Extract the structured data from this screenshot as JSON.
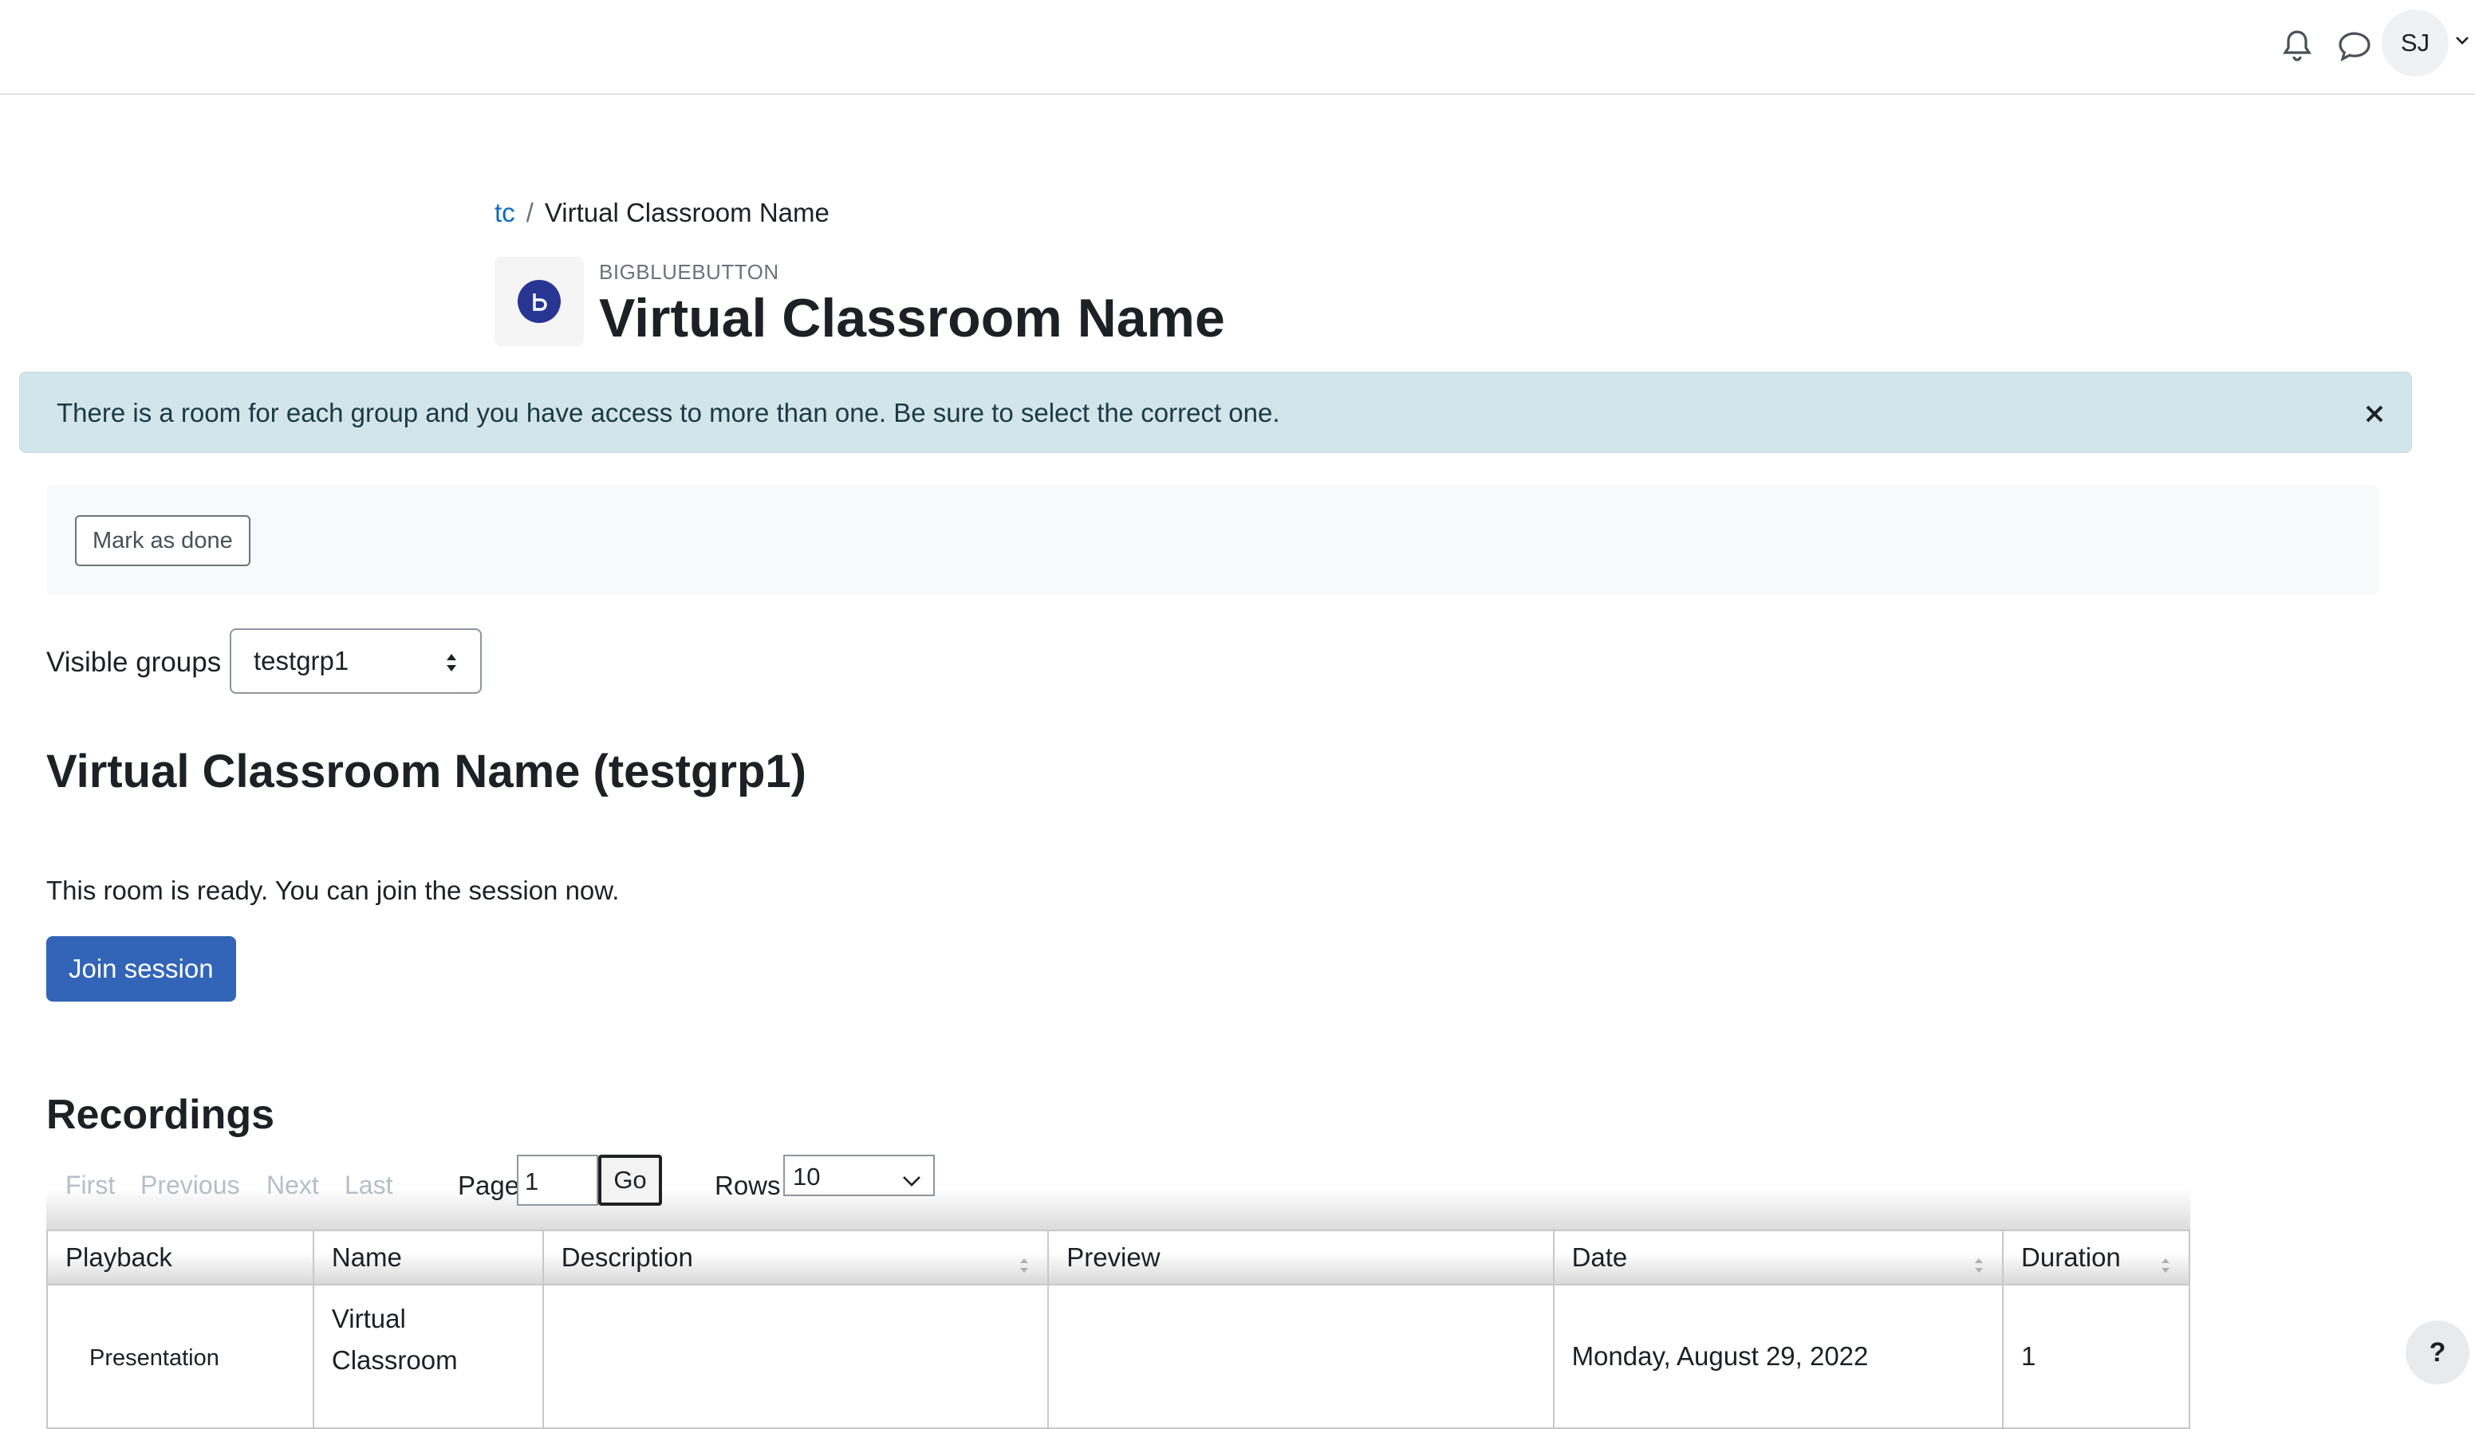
{
  "header": {
    "user_initials": "SJ"
  },
  "breadcrumb": {
    "course": "tc",
    "separator": "/",
    "current": "Virtual Classroom Name"
  },
  "activity": {
    "type_label": "BIGBLUEBUTTON",
    "title": "Virtual Classroom Name",
    "icon": "bigbluebutton-icon",
    "icon_color": "#283593"
  },
  "alert": {
    "message": "There is a room for each group and you have access to more than one. Be sure to select the correct one."
  },
  "completion": {
    "mark_done_label": "Mark as done"
  },
  "groups": {
    "label": "Visible groups",
    "selected": "testgrp1"
  },
  "room": {
    "title": "Virtual Classroom Name (testgrp1)",
    "status": "This room is ready. You can join the session now.",
    "join_label": "Join session"
  },
  "recordings": {
    "title": "Recordings",
    "pager": {
      "first": "First",
      "previous": "Previous",
      "next": "Next",
      "last": "Last",
      "page_label": "Page",
      "page_value": "1",
      "go_label": "Go",
      "rows_label": "Rows",
      "rows_value": "10"
    },
    "columns": [
      "Playback",
      "Name",
      "Description",
      "Preview",
      "Date",
      "Duration"
    ],
    "rows": [
      {
        "playback": "Presentation",
        "name": "Virtual Classroom",
        "description": "",
        "preview": "",
        "date": "Monday, August 29, 2022",
        "duration": "1"
      }
    ]
  },
  "help": {
    "label": "?"
  },
  "colors": {
    "primary": "#3264b8",
    "link": "#0f6cbf",
    "alert_bg": "#d2e5ea"
  }
}
